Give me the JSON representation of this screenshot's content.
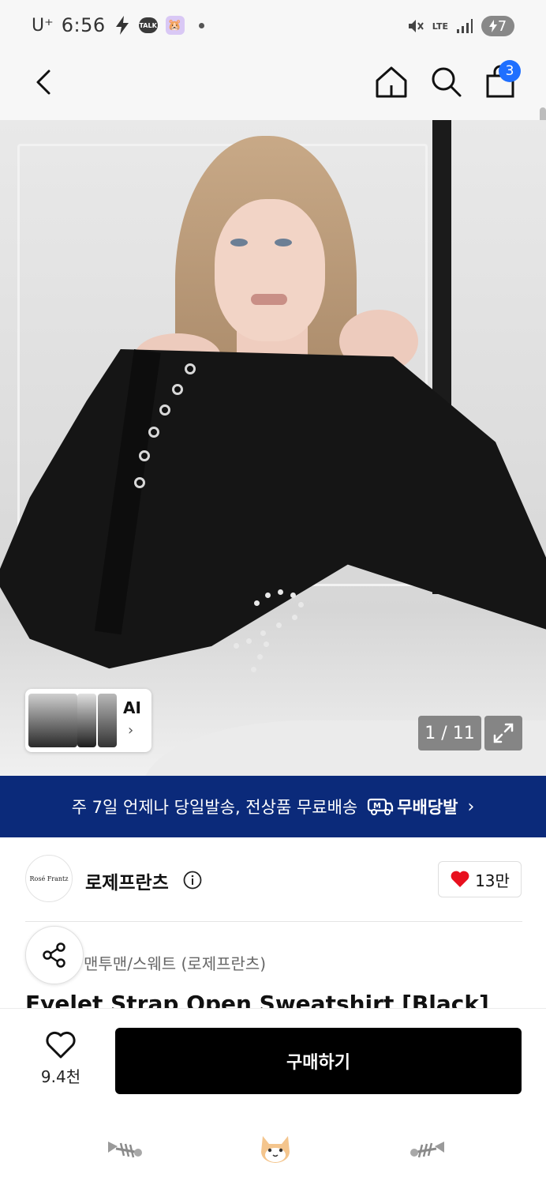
{
  "status_bar": {
    "carrier": "U⁺",
    "time": "6:56",
    "talk_badge": "TALK",
    "network": "LTE",
    "battery": "7"
  },
  "header": {
    "cart_count": "3",
    "icons": [
      "back-icon",
      "home-icon",
      "search-icon",
      "shopping-bag-icon"
    ]
  },
  "gallery": {
    "ai_label": "AI",
    "ai_chevron": "›",
    "counter": "1 / 11"
  },
  "banner": {
    "text": "주 7일 언제나 당일발송, 전상품 무료배송",
    "badge_label": "무배당발",
    "chevron": "›"
  },
  "brand": {
    "logo_text": "Rosé Frantz",
    "name": "로제프란츠",
    "like_count": "13만"
  },
  "product": {
    "category": "맨투맨/스웨트 (로제프란츠)",
    "title": "Eyelet Strap Open Sweatshirt [Black]"
  },
  "actions": {
    "wish_count": "9.4천",
    "buy_label": "구매하기"
  },
  "colors": {
    "banner_bg": "#0b2a7a",
    "cart_badge": "#1f6fff",
    "heart": "#e8101e",
    "buy_bg": "#000000"
  }
}
